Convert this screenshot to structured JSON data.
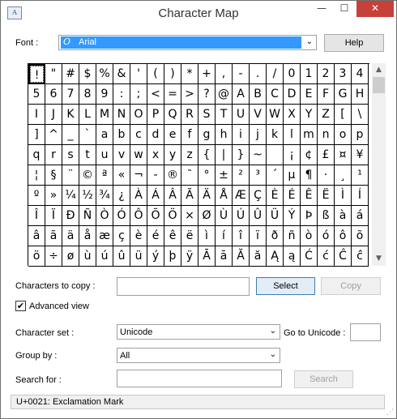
{
  "window": {
    "title": "Character Map",
    "app_icon_text": "A",
    "minimize": "—",
    "maximize": "☐",
    "close": "✕"
  },
  "font": {
    "label": "Font :",
    "value": "Arial",
    "icon": "O"
  },
  "help_button": "Help",
  "grid": {
    "rows": [
      [
        "!",
        "\"",
        "#",
        "$",
        "%",
        "&",
        "'",
        "(",
        ")",
        "*",
        "+",
        ",",
        "-",
        ".",
        "/",
        "0",
        "1",
        "2",
        "3",
        "4"
      ],
      [
        "5",
        "6",
        "7",
        "8",
        "9",
        ":",
        ";",
        "<",
        "=",
        ">",
        "?",
        "@",
        "A",
        "B",
        "C",
        "D",
        "E",
        "F",
        "G",
        "H"
      ],
      [
        "I",
        "J",
        "K",
        "L",
        "M",
        "N",
        "O",
        "P",
        "Q",
        "R",
        "S",
        "T",
        "U",
        "V",
        "W",
        "X",
        "Y",
        "Z",
        "[",
        "\\"
      ],
      [
        "]",
        "^",
        "_",
        "`",
        "a",
        "b",
        "c",
        "d",
        "e",
        "f",
        "g",
        "h",
        "i",
        "j",
        "k",
        "l",
        "m",
        "n",
        "o",
        "p"
      ],
      [
        "q",
        "r",
        "s",
        "t",
        "u",
        "v",
        "w",
        "x",
        "y",
        "z",
        "{",
        "|",
        "}",
        "~",
        " ",
        "¡",
        "¢",
        "£",
        "¤",
        "¥"
      ],
      [
        "¦",
        "§",
        "¨",
        "©",
        "ª",
        "«",
        "¬",
        "-",
        "®",
        "¯",
        "°",
        "±",
        "²",
        "³",
        "´",
        "µ",
        "¶",
        "·",
        "¸",
        "¹"
      ],
      [
        "º",
        "»",
        "¼",
        "½",
        "¾",
        "¿",
        "À",
        "Á",
        "Â",
        "Ã",
        "Ä",
        "Å",
        "Æ",
        "Ç",
        "È",
        "É",
        "Ê",
        "Ë",
        "Ì",
        "Í"
      ],
      [
        "Î",
        "Ï",
        "Ð",
        "Ñ",
        "Ò",
        "Ó",
        "Ô",
        "Õ",
        "Ö",
        "×",
        "Ø",
        "Ù",
        "Ú",
        "Û",
        "Ü",
        "Ý",
        "Þ",
        "ß",
        "à",
        "á"
      ],
      [
        "â",
        "ã",
        "ä",
        "å",
        "æ",
        "ç",
        "è",
        "é",
        "ê",
        "ë",
        "ì",
        "í",
        "î",
        "ï",
        "ð",
        "ñ",
        "ò",
        "ó",
        "ô",
        "õ"
      ],
      [
        "ö",
        "÷",
        "ø",
        "ù",
        "ú",
        "û",
        "ü",
        "ý",
        "þ",
        "ÿ",
        "Ā",
        "ā",
        "Ă",
        "ă",
        "Ą",
        "ą",
        "Ć",
        "ć",
        "Ĉ",
        "ĉ"
      ]
    ],
    "selected_char": "!"
  },
  "scrollbar": {
    "up_arrow": "▲",
    "down_arrow": "▼"
  },
  "copy": {
    "label": "Characters to copy :",
    "value": "",
    "select_button": "Select",
    "copy_button": "Copy"
  },
  "advanced_view": {
    "label": "Advanced view",
    "checked_mark": "✔"
  },
  "character_set": {
    "label": "Character set :",
    "value": "Unicode"
  },
  "goto_unicode": {
    "label": "Go to Unicode :",
    "value": ""
  },
  "group_by": {
    "label": "Group by :",
    "value": "All"
  },
  "search": {
    "label": "Search for :",
    "value": "",
    "button": "Search"
  },
  "combo_arrow": "⌄",
  "status": {
    "text": "U+0021: Exclamation Mark"
  },
  "colors": {
    "selection_blue": "#3399ff",
    "close_red": "#c7413a"
  }
}
